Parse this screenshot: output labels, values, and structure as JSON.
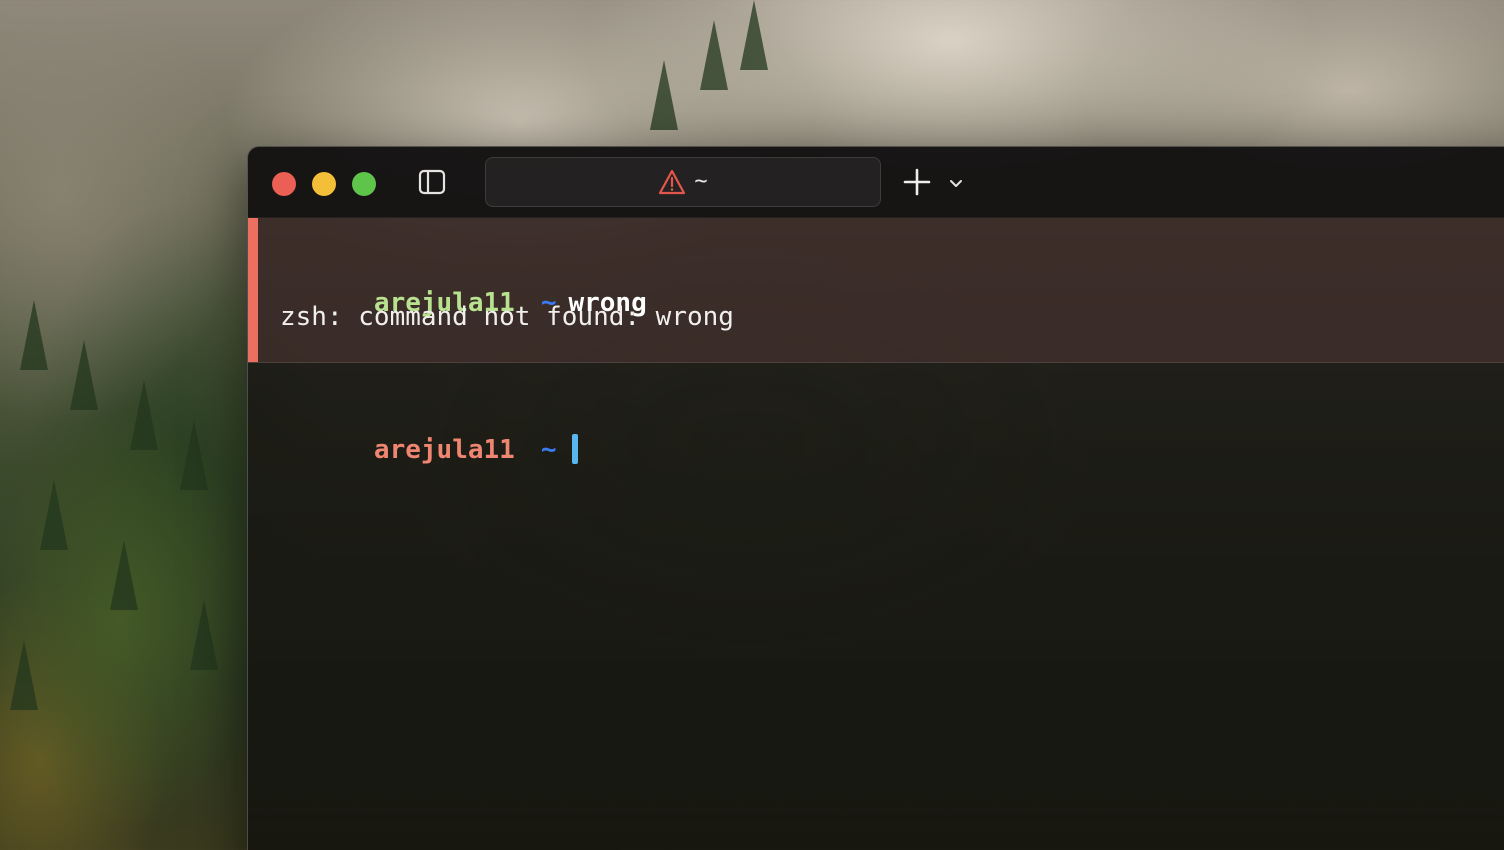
{
  "tab": {
    "title": "~",
    "icon": "warning-icon"
  },
  "toolbar": {
    "sidebar_icon": "sidebar-toggle-icon",
    "new_tab_icon": "plus-icon",
    "new_tab_menu_icon": "chevron-down-icon"
  },
  "blocks": {
    "error": {
      "user": "arejula11",
      "path": "~",
      "command": "wrong",
      "output": "zsh: command not found: wrong"
    },
    "current": {
      "user": "arejula11",
      "path": "~"
    }
  },
  "colors": {
    "error_accent": "#ec6f60",
    "user_ok": "#b8e28f",
    "user_error": "#ef8672",
    "path": "#3a7bf0",
    "cursor": "#57b7ee",
    "close": "#ec5f55",
    "minimize": "#f3bf38",
    "maximize": "#5ec54a"
  }
}
